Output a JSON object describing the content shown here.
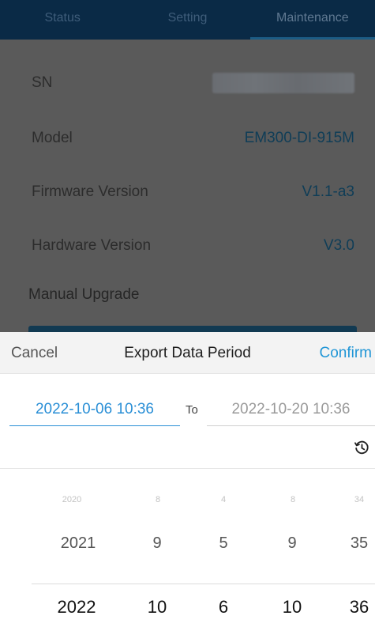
{
  "tabs": [
    {
      "label": "Status"
    },
    {
      "label": "Setting"
    },
    {
      "label": "Maintenance"
    }
  ],
  "info": {
    "sn_label": "SN",
    "model_label": "Model",
    "model_value": "EM300-DI-915M",
    "firmware_label": "Firmware Version",
    "firmware_value": "V1.1-a3",
    "hardware_label": "Hardware Version",
    "hardware_value": "V3.0",
    "upgrade_label": "Manual Upgrade"
  },
  "sheet": {
    "cancel": "Cancel",
    "title": "Export Data Period",
    "confirm": "Confirm",
    "from": "2022-10-06 10:36",
    "to_label": "To",
    "to": "2022-10-20 10:36"
  },
  "picker": {
    "rows": [
      [
        "2020",
        "8",
        "4",
        "8",
        "34"
      ],
      [
        "2021",
        "9",
        "5",
        "9",
        "35"
      ],
      [
        "2022",
        "10",
        "6",
        "10",
        "36"
      ]
    ]
  },
  "colors": {
    "accent": "#2196d6",
    "header_bg": "#0a2a46"
  },
  "icons": {
    "history": "history-icon"
  }
}
